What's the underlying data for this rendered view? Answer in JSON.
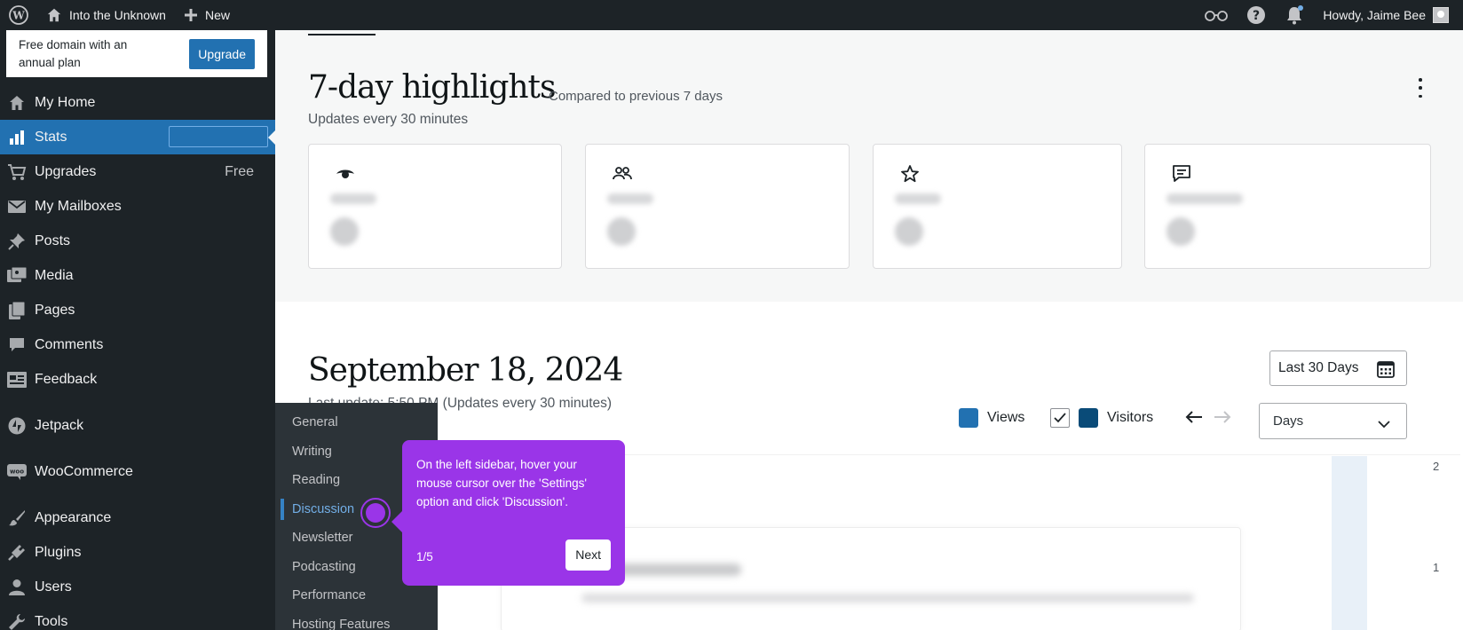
{
  "adminbar": {
    "site_name": "Into the Unknown",
    "new_label": "New",
    "greeting": "Howdy, Jaime Bee"
  },
  "promo": {
    "text": "Free domain with an annual plan",
    "button": "Upgrade"
  },
  "sidebar": {
    "items": [
      {
        "label": "My Home",
        "icon": "home-icon"
      },
      {
        "label": "Stats",
        "icon": "stats-icon",
        "active": true
      },
      {
        "label": "Upgrades",
        "icon": "cart-icon",
        "badge": "Free"
      },
      {
        "label": "My Mailboxes",
        "icon": "mail-icon"
      },
      {
        "label": "Posts",
        "icon": "pin-icon"
      },
      {
        "label": "Media",
        "icon": "media-icon"
      },
      {
        "label": "Pages",
        "icon": "pages-icon"
      },
      {
        "label": "Comments",
        "icon": "comment-icon"
      },
      {
        "label": "Feedback",
        "icon": "feedback-icon"
      },
      {
        "label": "Jetpack",
        "icon": "jetpack-icon"
      },
      {
        "label": "WooCommerce",
        "icon": "woo-icon"
      },
      {
        "label": "Appearance",
        "icon": "brush-icon"
      },
      {
        "label": "Plugins",
        "icon": "plugin-icon"
      },
      {
        "label": "Users",
        "icon": "user-icon"
      },
      {
        "label": "Tools",
        "icon": "wrench-icon"
      }
    ]
  },
  "submenu": {
    "items": [
      "General",
      "Writing",
      "Reading",
      "Discussion",
      "Newsletter",
      "Podcasting",
      "Performance",
      "Hosting Features"
    ],
    "current": "Discussion"
  },
  "highlights": {
    "title": "7-day highlights",
    "compare": "Compared to previous 7 days",
    "updates": "Updates every 30 minutes",
    "cards": [
      {
        "icon": "eye-icon"
      },
      {
        "icon": "people-icon"
      },
      {
        "icon": "star-icon"
      },
      {
        "icon": "comment-square-icon"
      }
    ]
  },
  "traffic": {
    "date": "September 18, 2024",
    "last_update": "Last update: 5:50 PM (Updates every 30 minutes)",
    "range_label": "Last 30 Days",
    "legend_views": "Views",
    "legend_visitors": "Visitors",
    "period_select": "Days",
    "y_ticks": [
      "2",
      "1"
    ],
    "colors": {
      "views": "#2271b1",
      "visitors": "#0a4b78"
    }
  },
  "tooltip": {
    "text": "On the left sidebar, hover your mouse cursor over the 'Settings' option and click 'Discussion'.",
    "step": "1/5",
    "next": "Next"
  }
}
